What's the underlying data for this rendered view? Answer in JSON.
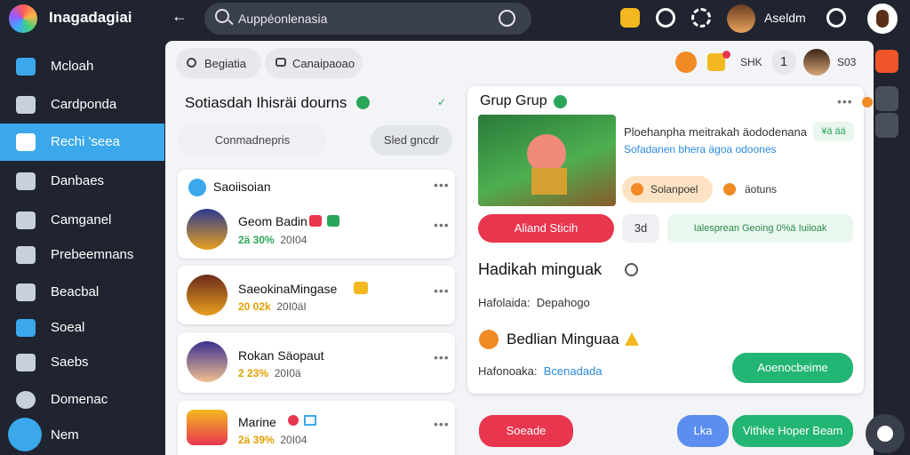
{
  "app": {
    "title": "Inagadagiai"
  },
  "search": {
    "placeholder": "Auppéonlenasia"
  },
  "user": {
    "name": "Aseldm",
    "badge_count": "1"
  },
  "sidebar": {
    "items": [
      {
        "label": "Mcloah",
        "icon": "home-icon"
      },
      {
        "label": "Cardponda",
        "icon": "list-icon"
      },
      {
        "label": "Rechi 'seea",
        "icon": "share-icon",
        "active": true
      },
      {
        "label": "Danbaes",
        "icon": "grid-icon"
      },
      {
        "label": "Camganel",
        "icon": "chart-icon"
      },
      {
        "label": "Prebeemnans",
        "icon": "pencil-icon"
      },
      {
        "label": "Beacbal",
        "icon": "camera-icon"
      },
      {
        "label": "Soeal",
        "icon": "bird-icon"
      },
      {
        "label": "Saebs",
        "icon": "people-icon"
      },
      {
        "label": "Domenac",
        "icon": "pin-icon"
      },
      {
        "label": "Nem",
        "icon": "bolt-icon"
      }
    ]
  },
  "toolbar": {
    "chip1": "Begiatia",
    "chip2": "Canaipaoao",
    "chip3": "SHK",
    "counter": "1",
    "count_text": "S03"
  },
  "left_panel": {
    "heading": "Sotiasdah Ihisräi dourns",
    "tab_a": "Conmadnepris",
    "tab_b": "Sled gncdr",
    "section_title": "Saoiisoian",
    "groups": [
      {
        "name": "Geom Badin",
        "pct": "2ä 30%",
        "num": "20I04"
      },
      {
        "name": "SaeokinaMingase",
        "pct": "20 02k",
        "num": "20I0äI"
      },
      {
        "name": "Rokan Säopaut",
        "pct": "2 23%",
        "num": "20I0ä"
      },
      {
        "name": "Marine",
        "pct": "2ä 39%",
        "num": "20I04"
      }
    ]
  },
  "right_panel": {
    "title": "Grup Grup",
    "desc_line1": "Ploehanpha meitrakah äododenana",
    "desc_line2": "Sofadanen bhera ägoa odoones",
    "small_chip": "¥ä ää",
    "tag1": "Solanpoel",
    "tag2": "äotuns",
    "primary_button": "Aliand Sticih",
    "count_chip": "3d",
    "status_chip": "Ialesprean Geoing 0%ä Iuiioak",
    "heading1": "Hadikah minguak",
    "row1_label": "Hafolaida:",
    "row1_value": "Depahogo",
    "heading2": "Bedlian Minguaa",
    "row2_label": "Hafonoaka:",
    "row2_value": "Bcenadada",
    "green_button": "Aoenocbeime"
  },
  "bottom": {
    "red_button": "Soeade",
    "blue_button": "Lka",
    "green_button": "Vithke Hoper Beam"
  },
  "colors": {
    "accent": "#3aa8ea",
    "red": "#e8364f",
    "green": "#22b573",
    "orange": "#f08a24",
    "blue": "#5b8ef0"
  }
}
